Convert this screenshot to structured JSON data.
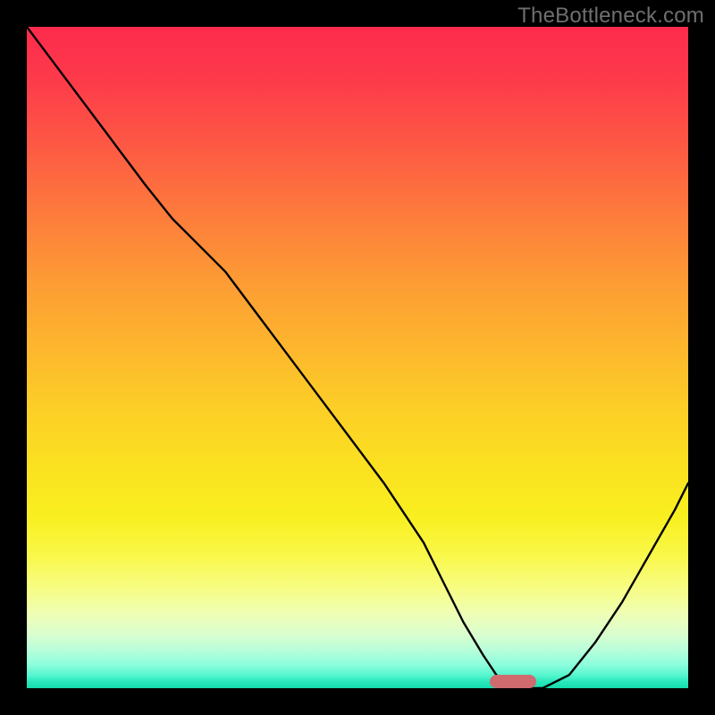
{
  "watermark": "TheBottleneck.com",
  "colors": {
    "page_bg": "#000000",
    "marker": "#cf6a6f",
    "curve": "#000000",
    "gradient_top": "#fd2b4d",
    "gradient_bottom": "#14dcac"
  },
  "chart_data": {
    "type": "line",
    "title": "",
    "xlabel": "",
    "ylabel": "",
    "xlim": [
      0,
      100
    ],
    "ylim": [
      0,
      100
    ],
    "grid": false,
    "legend": false,
    "series": [
      {
        "name": "bottleneck-curve",
        "x": [
          0,
          6,
          12,
          18,
          22,
          26,
          30,
          36,
          42,
          48,
          54,
          60,
          63,
          66,
          69,
          71,
          74,
          78,
          82,
          86,
          90,
          94,
          98,
          100
        ],
        "y": [
          100,
          92,
          84,
          76,
          71,
          67,
          63,
          55,
          47,
          39,
          31,
          22,
          16,
          10,
          5,
          2,
          0,
          0,
          2,
          7,
          13,
          20,
          27,
          31
        ]
      }
    ],
    "annotations": [
      {
        "name": "optimal-marker",
        "x_range": [
          70,
          77
        ],
        "y": 0
      }
    ],
    "background": "vertical-gradient red→yellow→green (top=bad, bottom=good)"
  }
}
